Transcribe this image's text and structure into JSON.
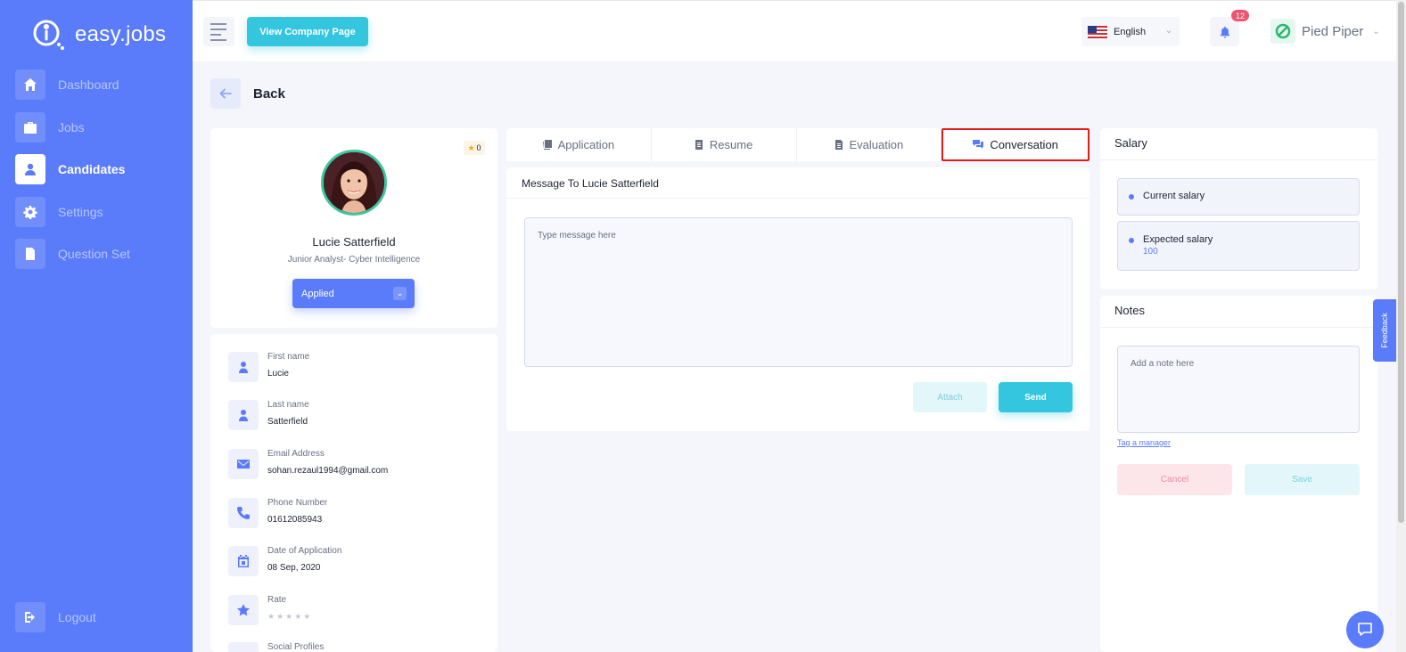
{
  "app": {
    "logo_text": "easy.jobs"
  },
  "sidebar": {
    "items": [
      {
        "label": "Dashboard",
        "icon": "home-icon"
      },
      {
        "label": "Jobs",
        "icon": "briefcase-icon"
      },
      {
        "label": "Candidates",
        "icon": "user-icon",
        "active": true
      },
      {
        "label": "Settings",
        "icon": "gear-icon"
      },
      {
        "label": "Question Set",
        "icon": "document-icon"
      }
    ],
    "logout_label": "Logout"
  },
  "header": {
    "company_button": "View Company Page",
    "language": "English",
    "notification_count": "12",
    "org_name": "Pied Piper"
  },
  "back_label": "Back",
  "candidate": {
    "rating_badge": "0",
    "name": "Lucie Satterfield",
    "role": "Junior Analyst- Cyber Intelligence",
    "status": "Applied",
    "fields": [
      {
        "label": "First name",
        "value": "Lucie",
        "icon": "user-icon"
      },
      {
        "label": "Last name",
        "value": "Satterfield",
        "icon": "user-icon"
      },
      {
        "label": "Email Address",
        "value": "sohan.rezaul1994@gmail.com",
        "icon": "envelope-icon"
      },
      {
        "label": "Phone Number",
        "value": "01612085943",
        "icon": "phone-icon"
      },
      {
        "label": "Date of Application",
        "value": "08 Sep, 2020",
        "icon": "calendar-icon"
      },
      {
        "label": "Rate",
        "value": "",
        "icon": "star-icon"
      },
      {
        "label": "Social Profiles",
        "value": "",
        "icon": "share-icon"
      }
    ],
    "rate_stars": "★★★★★"
  },
  "tabs": [
    {
      "label": "Application",
      "icon": "application-icon"
    },
    {
      "label": "Resume",
      "icon": "resume-icon"
    },
    {
      "label": "Evaluation",
      "icon": "evaluation-icon"
    },
    {
      "label": "Conversation",
      "icon": "chat-icon",
      "active": true
    }
  ],
  "conversation": {
    "title": "Message To Lucie Satterfield",
    "placeholder": "Type message here",
    "attach_label": "Attach",
    "send_label": "Send"
  },
  "salary": {
    "title": "Salary",
    "current_label": "Current salary",
    "expected_label": "Expected salary",
    "expected_value": "100"
  },
  "notes": {
    "title": "Notes",
    "placeholder": "Add a note here",
    "tag_link": "Tag a manager",
    "cancel_label": "Cancel",
    "save_label": "Save"
  },
  "feedback_label": "Feedback",
  "colors": {
    "primary": "#5b7cfa",
    "accent": "#33c6de",
    "danger": "#f05570"
  }
}
